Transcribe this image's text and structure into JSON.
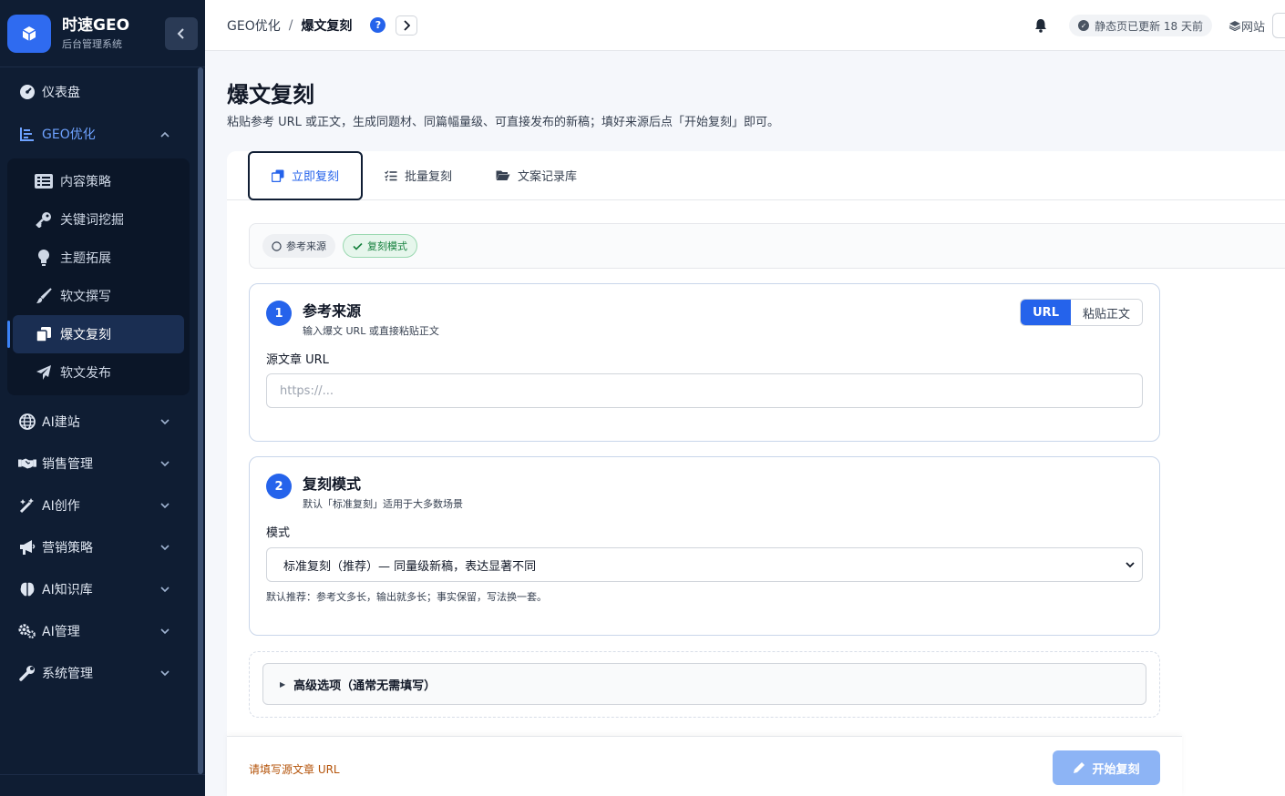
{
  "brand": {
    "title": "时速GEO",
    "subtitle": "后台管理系统"
  },
  "sidebar": {
    "items": [
      {
        "label": "仪表盘",
        "icon": "gauge-icon"
      },
      {
        "label": "GEO优化",
        "icon": "chart-bar-icon",
        "expanded": true,
        "children": [
          {
            "label": "内容策略",
            "icon": "list-icon"
          },
          {
            "label": "关键词挖掘",
            "icon": "key-icon"
          },
          {
            "label": "主题拓展",
            "icon": "lightbulb-icon"
          },
          {
            "label": "软文撰写",
            "icon": "brush-icon"
          },
          {
            "label": "爆文复刻",
            "icon": "copy-icon",
            "active": true
          },
          {
            "label": "软文发布",
            "icon": "paper-plane-icon"
          }
        ]
      },
      {
        "label": "AI建站",
        "icon": "globe-icon"
      },
      {
        "label": "销售管理",
        "icon": "handshake-icon"
      },
      {
        "label": "AI创作",
        "icon": "magic-wand-icon"
      },
      {
        "label": "营销策略",
        "icon": "megaphone-icon"
      },
      {
        "label": "AI知识库",
        "icon": "brain-icon"
      },
      {
        "label": "AI管理",
        "icon": "gears-icon"
      },
      {
        "label": "系统管理",
        "icon": "wrench-icon"
      }
    ]
  },
  "topbar": {
    "breadcrumb": [
      "GEO优化",
      "爆文复刻"
    ],
    "breadcrumb_sep": "/",
    "help": "?",
    "status": "静态页已更新 18 天前",
    "site_link": "网站"
  },
  "page": {
    "title": "爆文复刻",
    "description": "粘贴参考 URL 或正文，生成同题材、同篇幅量级、可直接发布的新稿；填好来源后点「开始复刻」即可。"
  },
  "tabs": [
    {
      "label": "立即复刻",
      "icon": "copy-icon",
      "active": true
    },
    {
      "label": "批量复刻",
      "icon": "checklist-icon"
    },
    {
      "label": "文案记录库",
      "icon": "folder-open-icon"
    }
  ],
  "steps": [
    {
      "label": "参考来源",
      "done": false
    },
    {
      "label": "复刻模式",
      "done": true
    }
  ],
  "section1": {
    "number": "1",
    "title": "参考来源",
    "subtitle": "输入爆文 URL 或直接粘贴正文",
    "toggle": [
      "URL",
      "粘贴正文"
    ],
    "field_label": "源文章 URL",
    "input_placeholder": "https://..."
  },
  "section2": {
    "number": "2",
    "title": "复刻模式",
    "subtitle": "默认「标准复刻」适用于大多数场景",
    "field_label": "模式",
    "select_value": "标准复刻（推荐）— 同量级新稿，表达显著不同",
    "hint": "默认推荐：参考文多长，输出就多长；事实保留，写法换一套。"
  },
  "advanced": {
    "label": "高级选项（通常无需填写）"
  },
  "footer": {
    "warning": "请填写源文章 URL",
    "start_label": "开始复刻"
  },
  "colors": {
    "sidebar_bg": "#0f1d33",
    "accent": "#2563eb",
    "warning": "#b45309",
    "success": "#15803d"
  }
}
